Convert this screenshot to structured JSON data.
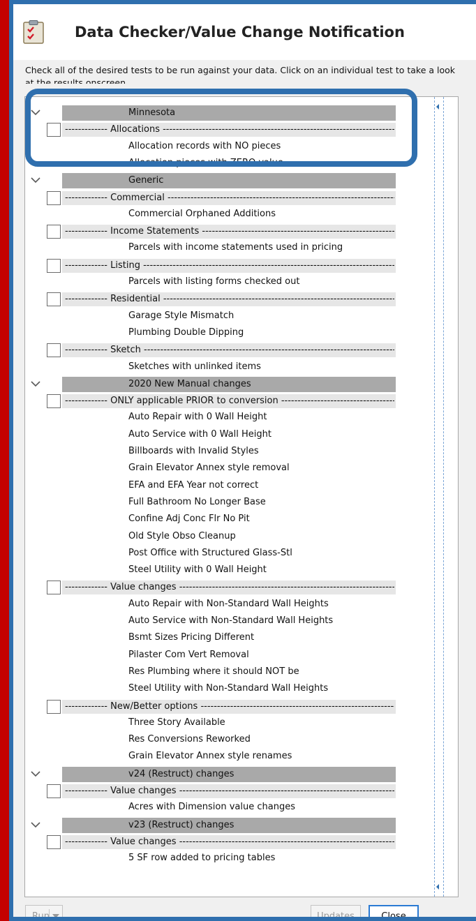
{
  "window": {
    "title": "Data Checker/Value Change Notification",
    "description": "Check all of the desired tests to be run against your data. Click on an individual test to take a look at the results onscreen."
  },
  "dash_prefix": "------------- ",
  "rows": [
    {
      "kind": "state",
      "label": "Minnesota"
    },
    {
      "kind": "category",
      "label": "Allocations"
    },
    {
      "kind": "test",
      "label": "Allocation records with NO pieces"
    },
    {
      "kind": "test",
      "label": "Allocation pieces with ZERO value"
    },
    {
      "kind": "state",
      "label": "Generic"
    },
    {
      "kind": "category",
      "label": "Commercial"
    },
    {
      "kind": "test",
      "label": "Commercial Orphaned Additions"
    },
    {
      "kind": "category",
      "label": "Income Statements"
    },
    {
      "kind": "test",
      "label": "Parcels with income statements used in pricing"
    },
    {
      "kind": "category",
      "label": "Listing"
    },
    {
      "kind": "test",
      "label": "Parcels with listing forms checked out"
    },
    {
      "kind": "category",
      "label": "Residential"
    },
    {
      "kind": "test",
      "label": "Garage Style Mismatch"
    },
    {
      "kind": "test",
      "label": "Plumbing Double Dipping"
    },
    {
      "kind": "category",
      "label": "Sketch"
    },
    {
      "kind": "test",
      "label": "Sketches with unlinked items"
    },
    {
      "kind": "state",
      "label": "2020 New Manual changes"
    },
    {
      "kind": "category",
      "label": "ONLY applicable PRIOR to conversion"
    },
    {
      "kind": "test",
      "label": "Auto Repair with 0 Wall Height"
    },
    {
      "kind": "test",
      "label": "Auto Service with 0 Wall Height"
    },
    {
      "kind": "test",
      "label": "Billboards with Invalid Styles"
    },
    {
      "kind": "test",
      "label": "Grain Elevator Annex style removal"
    },
    {
      "kind": "test",
      "label": "EFA and EFA Year not correct"
    },
    {
      "kind": "test",
      "label": "Full Bathroom No Longer Base"
    },
    {
      "kind": "test",
      "label": "Confine Adj Conc Flr No Pit"
    },
    {
      "kind": "test",
      "label": "Old Style Obso Cleanup"
    },
    {
      "kind": "test",
      "label": "Post Office with Structured Glass-Stl"
    },
    {
      "kind": "test",
      "label": "Steel Utility with 0 Wall Height"
    },
    {
      "kind": "category",
      "label": "Value changes"
    },
    {
      "kind": "test",
      "label": "Auto Repair with Non-Standard Wall Heights"
    },
    {
      "kind": "test",
      "label": "Auto Service with Non-Standard Wall Heights"
    },
    {
      "kind": "test",
      "label": "Bsmt Sizes Pricing Different"
    },
    {
      "kind": "test",
      "label": "Pilaster Com Vert Removal"
    },
    {
      "kind": "test",
      "label": "Res Plumbing where it should NOT be"
    },
    {
      "kind": "test",
      "label": "Steel Utility with Non-Standard Wall Heights"
    },
    {
      "kind": "category",
      "label": "New/Better options"
    },
    {
      "kind": "test",
      "label": "Three Story Available"
    },
    {
      "kind": "test",
      "label": "Res Conversions Reworked"
    },
    {
      "kind": "test",
      "label": "Grain Elevator Annex style renames"
    },
    {
      "kind": "state",
      "label": "v24 (Restruct) changes"
    },
    {
      "kind": "category",
      "label": "Value changes"
    },
    {
      "kind": "test",
      "label": "Acres with Dimension value changes"
    },
    {
      "kind": "state",
      "label": "v23 (Restruct) changes"
    },
    {
      "kind": "category",
      "label": "Value changes"
    },
    {
      "kind": "test",
      "label": "5 SF row added to pricing tables"
    }
  ],
  "buttons": {
    "run": "Run",
    "updates": "Updates",
    "close": "Close"
  },
  "colors": {
    "outer_background": "#c40000",
    "frame_border": "#2f6fae",
    "highlight_outline": "#2f6fae",
    "state_band": "#a9a9a9",
    "category_band": "#e6e6e6"
  },
  "icons": {
    "title": "checklist-clipboard-icon",
    "expand": "chevron-down-icon",
    "run_dropdown": "dropdown-arrow-icon"
  }
}
